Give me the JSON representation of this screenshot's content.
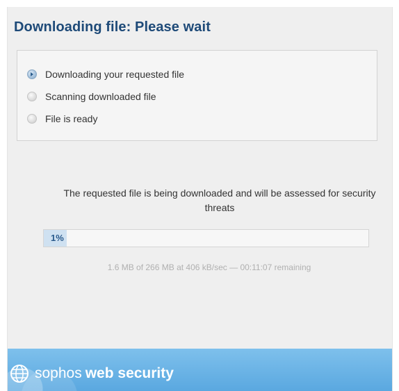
{
  "title": "Downloading file: Please wait",
  "steps": [
    {
      "label": "Downloading your requested file",
      "state": "active"
    },
    {
      "label": "Scanning downloaded file",
      "state": "pending"
    },
    {
      "label": "File is ready",
      "state": "pending"
    }
  ],
  "message": "The requested file is being downloaded and will be assessed for security threats",
  "progress": {
    "label": "1%",
    "value_percent": 1
  },
  "stats": "1.6 MB of 266 MB at 406 kB/sec — 00:11:07 remaining",
  "footer": {
    "brand": "sophos",
    "product": "web security",
    "icon": "globe-icon"
  },
  "colors": {
    "title": "#1e4a78",
    "footer": "#6cb5e6",
    "progress_fill": "#cfe1f1"
  }
}
